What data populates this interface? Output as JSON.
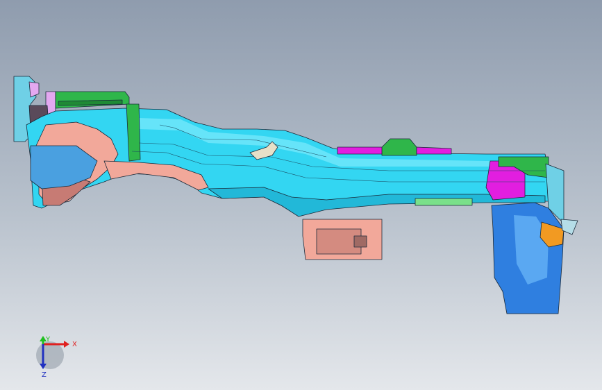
{
  "viewport": {
    "background_top": "#8f9cae",
    "background_bottom": "#e4e7eb"
  },
  "model": {
    "part_colors": {
      "main_rail": "#33d6f2",
      "rear_bracket": "#6fd0e6",
      "salmon_parts": "#f2a89a",
      "green_parts": "#2fb64a",
      "magenta_parts": "#e21ee0",
      "blue_bracket": "#2f7fe0",
      "orange_part": "#f29a22",
      "lavender_part": "#e3a8f0"
    }
  },
  "triad": {
    "x_label": "X",
    "y_label": "Y",
    "z_label": "Z",
    "x_color": "#e02020",
    "y_color": "#20c020",
    "z_color": "#2030c0"
  }
}
